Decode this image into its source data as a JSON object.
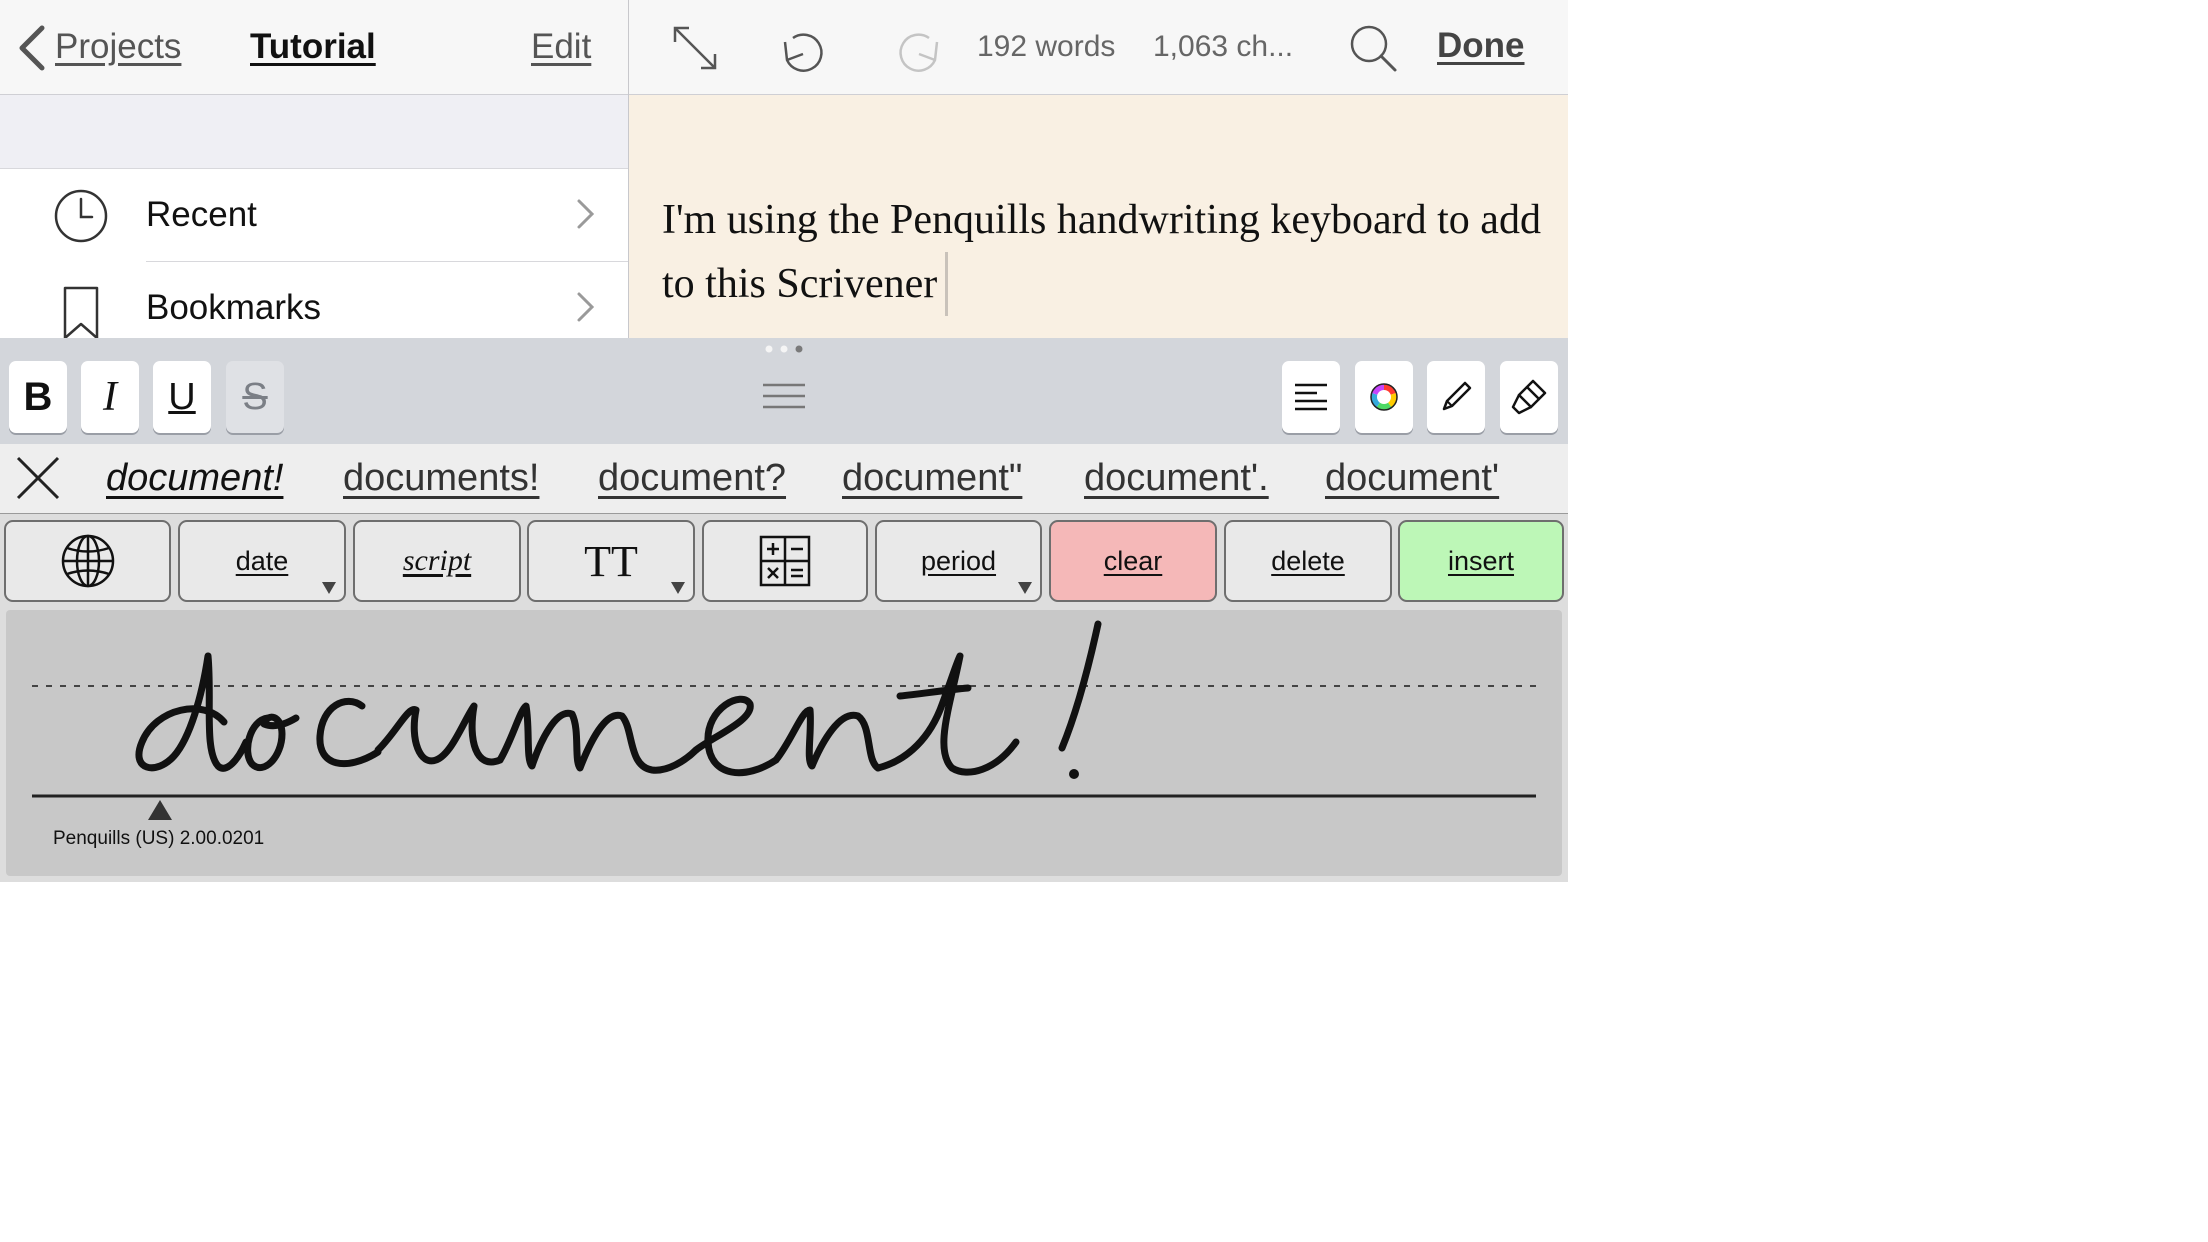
{
  "left_nav": {
    "back_label": "Projects",
    "title": "Tutorial",
    "edit_label": "Edit",
    "rows": [
      {
        "label": "Recent",
        "icon": "clock-icon"
      },
      {
        "label": "Bookmarks",
        "icon": "bookmark-icon"
      }
    ]
  },
  "editor": {
    "word_count": "192 words",
    "char_count": "1,063 ch...",
    "done_label": "Done",
    "text": "I'm using the Penquills handwriting keyboard to add to this Scrivener",
    "background_color": "#f9f0e3"
  },
  "format_bar": {
    "bold_label": "B",
    "italic_label": "I",
    "underline_label": "U",
    "strike_label": "S",
    "right_icons": [
      "align-left-icon",
      "color-wheel-icon",
      "pencil-icon",
      "brush-icon"
    ]
  },
  "suggestions": [
    "document!",
    "documents!",
    "document?",
    "document\"",
    "document'.",
    "document'"
  ],
  "keyboard": {
    "keys": {
      "globe": "globe-icon",
      "date": "date",
      "script": "script",
      "size": "TT",
      "calculator": "calculator-icon",
      "period": "period",
      "clear": "clear",
      "delete": "delete",
      "insert": "insert"
    },
    "clear_color": "#f5b8b8",
    "insert_color": "#bdf7b7",
    "handwriting_text": "document!",
    "version": "Penquills (US) 2.00.0201"
  }
}
